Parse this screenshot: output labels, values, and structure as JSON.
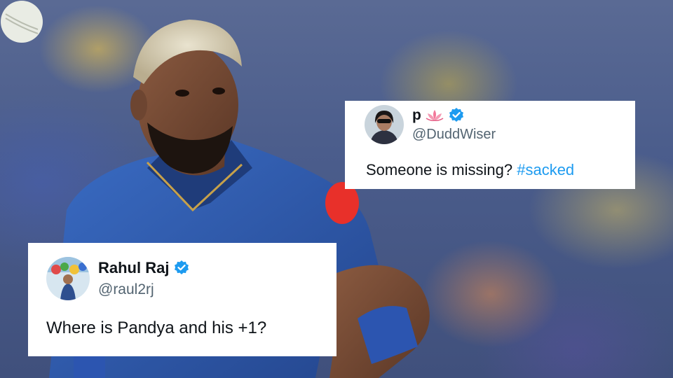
{
  "tweets": [
    {
      "display_name": "p",
      "name_emoji": "lotus-emoji",
      "verified": true,
      "handle": "@DuddWiser",
      "text": "Someone is missing? ",
      "hashtag": "#sacked"
    },
    {
      "display_name": "Rahul Raj",
      "verified": true,
      "handle": "@raul2rj",
      "text": "Where is Pandya and his +1?"
    }
  ],
  "colors": {
    "hashtag": "#1d9bf0",
    "verified": "#1d9bf0",
    "handle": "#536471",
    "jersey": "#2f5db0",
    "sponsor_badge": "#e8302a"
  }
}
